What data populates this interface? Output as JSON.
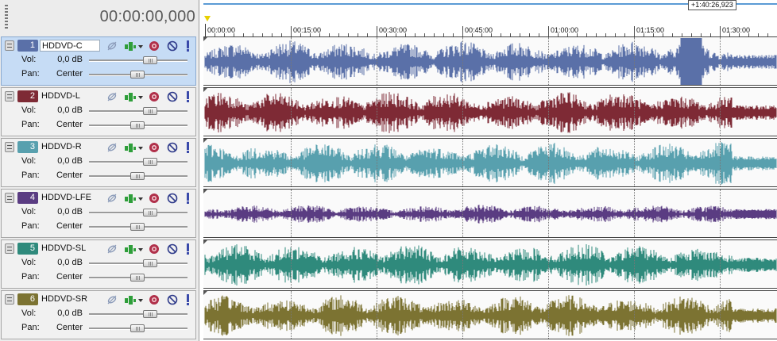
{
  "timecode": "00:00:00,000",
  "end_label": "+1:40:26,923",
  "ruler": [
    "00:00:00",
    "00:15:00",
    "00:30:00",
    "00:45:00",
    "01:00:00",
    "01:15:00",
    "01:30:00"
  ],
  "tracks": [
    {
      "number": "1",
      "name": "HDDVD-C",
      "vol_label": "Vol:",
      "vol_value": "0,0 dB",
      "pan_label": "Pan:",
      "pan_value": "Center",
      "color": "#5a70a8",
      "selected": true
    },
    {
      "number": "2",
      "name": "HDDVD-L",
      "vol_label": "Vol:",
      "vol_value": "0,0 dB",
      "pan_label": "Pan:",
      "pan_value": "Center",
      "color": "#7e2a35",
      "selected": false
    },
    {
      "number": "3",
      "name": "HDDVD-R",
      "vol_label": "Vol:",
      "vol_value": "0,0 dB",
      "pan_label": "Pan:",
      "pan_value": "Center",
      "color": "#58a0ae",
      "selected": false
    },
    {
      "number": "4",
      "name": "HDDVD-LFE",
      "vol_label": "Vol:",
      "vol_value": "0,0 dB",
      "pan_label": "Pan:",
      "pan_value": "Center",
      "color": "#5a3c82",
      "selected": false
    },
    {
      "number": "5",
      "name": "HDDVD-SL",
      "vol_label": "Vol:",
      "vol_value": "0,0 dB",
      "pan_label": "Pan:",
      "pan_value": "Center",
      "color": "#2f8a7c",
      "selected": false
    },
    {
      "number": "6",
      "name": "HDDVD-SR",
      "vol_label": "Vol:",
      "vol_value": "0,0 dB",
      "pan_label": "Pan:",
      "pan_value": "Center",
      "color": "#7c7332",
      "selected": false
    }
  ],
  "icons": {
    "bypass": "bypass-fx-icon",
    "fx": "track-fx-icon",
    "automation": "automation-icon",
    "mute": "mute-icon",
    "solo": "solo-icon",
    "icon_colors": {
      "bypass": "#8a9ab8",
      "fx": "#2e9e3a",
      "automation": "#b0304a",
      "mute": "#2e3a8a",
      "solo": "#3a4aaa"
    }
  },
  "ui_colors": {
    "selected_header": "#c6dcf5",
    "header": "#f1f1f1",
    "lane_bg": "#fafafa",
    "timeline_line": "#5b9bd5",
    "marker": "#e8d000"
  }
}
